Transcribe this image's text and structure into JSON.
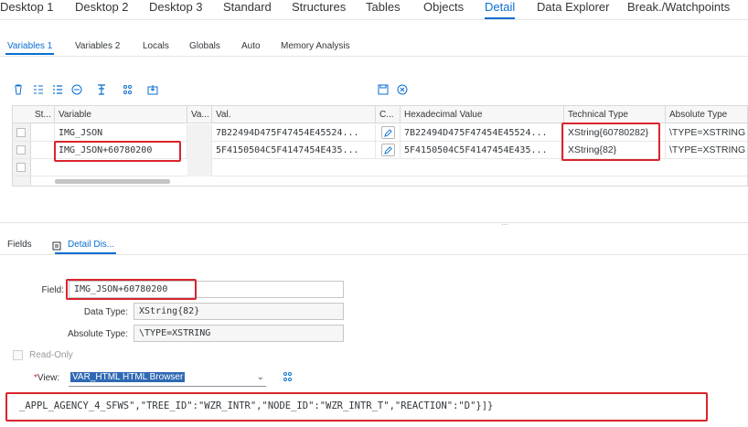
{
  "top_tabs": [
    {
      "label": "Desktop 1"
    },
    {
      "label": "Desktop 2"
    },
    {
      "label": "Desktop 3"
    },
    {
      "label": "Standard"
    },
    {
      "label": "Structures"
    },
    {
      "label": "Tables"
    },
    {
      "label": "Objects"
    },
    {
      "label": "Detail",
      "active": true
    },
    {
      "label": "Data Explorer"
    },
    {
      "label": "Break./Watchpoints"
    }
  ],
  "sub_tabs": [
    {
      "label": "Variables 1",
      "active": true
    },
    {
      "label": "Variables 2"
    },
    {
      "label": "Locals"
    },
    {
      "label": "Globals"
    },
    {
      "label": "Auto"
    },
    {
      "label": "Memory Analysis"
    }
  ],
  "toolbar_icons": [
    "delete-icon",
    "multi-select-icon",
    "list-icon",
    "remove-icon",
    "settings-icon",
    "variable-icon",
    "export-icon",
    "save-icon",
    "close-circle-icon"
  ],
  "grid": {
    "headers": [
      "St...",
      "Variable",
      "Va...",
      "Val.",
      "C...",
      "Hexadecimal Value",
      "Technical Type",
      "Absolute Type"
    ],
    "rows": [
      {
        "variable": "IMG_JSON",
        "val": "7B22494D475F47454E45524...",
        "hex": "7B22494D475F47454E45524...",
        "technical_type": "XString{60780282}",
        "absolute_type": "\\TYPE=XSTRING"
      },
      {
        "variable": "IMG_JSON+60780200",
        "val": "5F4150504C5F4147454E435...",
        "hex": "5F4150504C5F4147454E435...",
        "technical_type": "XString{82}",
        "absolute_type": "\\TYPE=XSTRING"
      }
    ]
  },
  "lower_tabs": [
    {
      "label": "Fields"
    },
    {
      "label": "Detail Dis...",
      "active": true
    }
  ],
  "detail": {
    "field_label": "Field:",
    "field_value": "IMG_JSON+60780200",
    "data_type_label": "Data Type:",
    "data_type_value": "XString{82}",
    "absolute_type_label": "Absolute Type:",
    "absolute_type_value": "\\TYPE=XSTRING",
    "readonly_label": "Read-Only",
    "view_label_required": "*",
    "view_label": "View:",
    "view_value": "VAR_HTML HTML Browser",
    "output_text": "_APPL_AGENCY_4_SFWS\",\"TREE_ID\":\"WZR_INTR\",\"NODE_ID\":\"WZR_INTR_T\",\"REACTION\":\"D\"}]}"
  },
  "colors": {
    "accent": "#0a6ed1",
    "highlight_box": "#d9242c",
    "selected_option": "#2f69b4"
  }
}
